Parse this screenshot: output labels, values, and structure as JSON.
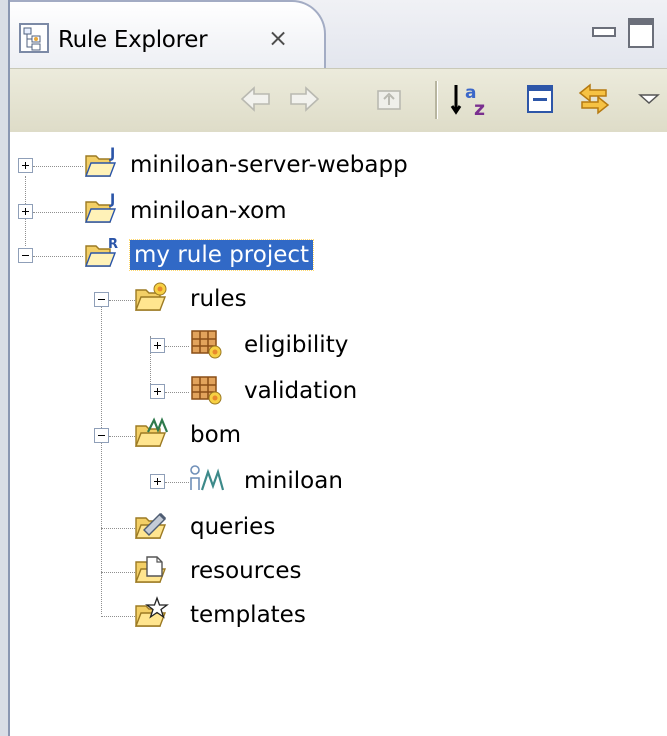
{
  "view": {
    "title": "Rule Explorer",
    "close_glyph": "⨯",
    "tab_icon": "rule-explorer-icon"
  },
  "toolbar": {
    "buttons": [
      {
        "name": "back-button",
        "icon": "arrow-left-icon",
        "enabled": false
      },
      {
        "name": "forward-button",
        "icon": "arrow-right-icon",
        "enabled": false
      },
      {
        "name": "up-button",
        "icon": "up-folder-icon",
        "enabled": false
      },
      {
        "name": "sort-button",
        "icon": "sort-az-icon",
        "enabled": true
      },
      {
        "name": "collapse-all-button",
        "icon": "collapse-all-icon",
        "enabled": true
      },
      {
        "name": "link-editor-button",
        "icon": "link-editor-icon",
        "enabled": true
      },
      {
        "name": "view-menu-button",
        "icon": "view-menu-icon",
        "enabled": true
      }
    ]
  },
  "tree": {
    "nodes": [
      {
        "label": "miniloan-server-webapp",
        "icon": "java-project-icon",
        "expanded": false,
        "depth": 0
      },
      {
        "label": "miniloan-xom",
        "icon": "java-project-icon",
        "expanded": false,
        "depth": 0
      },
      {
        "label": "my rule project",
        "icon": "rule-project-icon",
        "expanded": true,
        "depth": 0,
        "selected": true
      },
      {
        "label": "rules",
        "icon": "rules-folder-icon",
        "expanded": true,
        "depth": 1
      },
      {
        "label": "eligibility",
        "icon": "rule-package-icon",
        "expanded": false,
        "depth": 2
      },
      {
        "label": "validation",
        "icon": "rule-package-icon",
        "expanded": false,
        "depth": 2
      },
      {
        "label": "bom",
        "icon": "bom-folder-icon",
        "expanded": true,
        "depth": 1
      },
      {
        "label": "miniloan",
        "icon": "bom-entry-icon",
        "expanded": false,
        "depth": 2
      },
      {
        "label": "queries",
        "icon": "queries-folder-icon",
        "depth": 1
      },
      {
        "label": "resources",
        "icon": "resources-folder-icon",
        "depth": 1
      },
      {
        "label": "templates",
        "icon": "templates-folder-icon",
        "depth": 1
      }
    ]
  },
  "colors": {
    "selection": "#3169c6",
    "folder": "#f5d36b",
    "toolbar": "#e4e2cf"
  }
}
